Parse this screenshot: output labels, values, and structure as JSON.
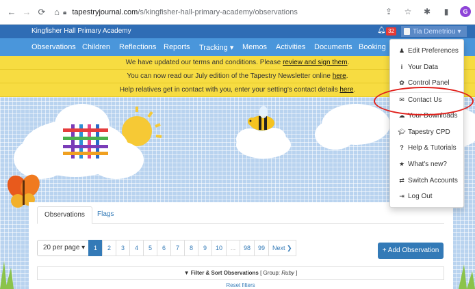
{
  "browser": {
    "url_host": "tapestryjournal.com",
    "url_path": "/s/kingfisher-hall-primary-academy/observations",
    "profile_initial": "G"
  },
  "school_bar": {
    "name": "Kingfisher Hall Primary Academy",
    "notification_count": "32",
    "user_name": "Tia Demetriou",
    "user_caret": "▾"
  },
  "nav": {
    "items": [
      "Observations",
      "Children",
      "Reflections",
      "Reports",
      "Tracking ▾",
      "Memos",
      "Activities",
      "Documents",
      "Booking"
    ]
  },
  "notices": [
    {
      "text": "We have updated our terms and conditions. Please ",
      "link": "review and sign them",
      "suffix": "."
    },
    {
      "text": "You can now read our July edition of the Tapestry Newsletter online ",
      "link": "here",
      "suffix": "."
    },
    {
      "text": "Help relatives get in contact with you, enter your setting's contact details ",
      "link": "here",
      "suffix": "."
    }
  ],
  "tabs": {
    "observations": "Observations",
    "flags": "Flags"
  },
  "pagination": {
    "per_page": "20 per page ▾",
    "pages": [
      "1",
      "2",
      "3",
      "4",
      "5",
      "6",
      "7",
      "8",
      "9",
      "10",
      "...",
      "98",
      "99"
    ],
    "current": 0,
    "next": "Next ❯"
  },
  "add_observation": "+ Add Observation",
  "filter": {
    "label": "Filter & Sort Observations",
    "group_prefix": " [ Group: ",
    "group_value": "Ruby",
    "group_suffix": " ]"
  },
  "reset_filters": "Reset filters",
  "dropdown": {
    "items": [
      {
        "label": "Edit Preferences",
        "icon": "person-icon"
      },
      {
        "label": "Your Data",
        "icon": "info-icon"
      },
      {
        "label": "Control Panel",
        "icon": "gear-icon"
      },
      {
        "label": "Contact Us",
        "icon": "envelope-icon"
      },
      {
        "label": "Your Downloads",
        "icon": "cloud-download-icon"
      },
      {
        "label": "Tapestry CPD",
        "icon": "graduation-cap-icon"
      },
      {
        "label": "Help & Tutorials",
        "icon": "question-icon"
      },
      {
        "label": "What's new?",
        "icon": "star-icon"
      },
      {
        "label": "Switch Accounts",
        "icon": "switch-icon"
      },
      {
        "label": "Log Out",
        "icon": "logout-icon"
      }
    ]
  },
  "colors": {
    "school_bar": "#2f6db5",
    "nav": "#4a96db",
    "notice": "#f7dc41",
    "primary": "#337ab7",
    "highlight": "#e0201b"
  }
}
